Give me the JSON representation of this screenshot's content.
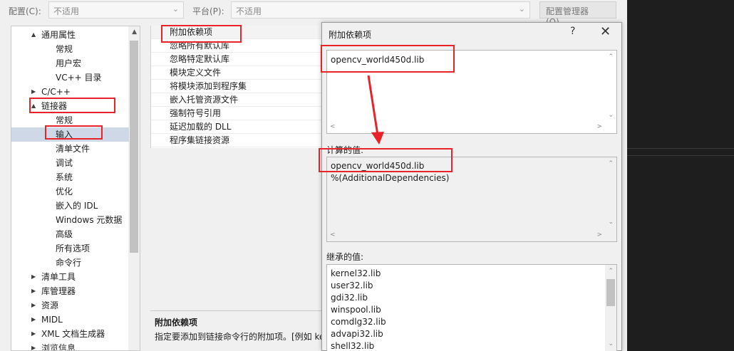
{
  "toolbar": {
    "config_label": "配置(C):",
    "config_value": "不适用",
    "platform_label": "平台(P):",
    "platform_value": "不适用",
    "config_manager_button": "配置管理器(O)..."
  },
  "tree": {
    "items": [
      {
        "label": "通用属性",
        "expander": "▲"
      },
      {
        "label": "常规"
      },
      {
        "label": "用户宏"
      },
      {
        "label": "VC++ 目录"
      },
      {
        "label": "C/C++",
        "expander": "▶"
      },
      {
        "label": "链接器",
        "expander": "▲"
      },
      {
        "label": "常规"
      },
      {
        "label": "输入"
      },
      {
        "label": "清单文件"
      },
      {
        "label": "调试"
      },
      {
        "label": "系统"
      },
      {
        "label": "优化"
      },
      {
        "label": "嵌入的 IDL"
      },
      {
        "label": "Windows 元数据"
      },
      {
        "label": "高级"
      },
      {
        "label": "所有选项"
      },
      {
        "label": "命令行"
      },
      {
        "label": "清单工具",
        "expander": "▶"
      },
      {
        "label": "库管理器",
        "expander": "▶"
      },
      {
        "label": "资源",
        "expander": "▶"
      },
      {
        "label": "MIDL",
        "expander": "▶"
      },
      {
        "label": "XML 文档生成器",
        "expander": "▶"
      },
      {
        "label": "浏览信息",
        "expander": "▶"
      }
    ]
  },
  "grid": {
    "rows": [
      "附加依赖项",
      "忽略所有默认库",
      "忽略特定默认库",
      "模块定义文件",
      "将模块添加到程序集",
      "嵌入托管资源文件",
      "强制符号引用",
      "延迟加载的 DLL",
      "程序集链接资源"
    ]
  },
  "description": {
    "title": "附加依赖项",
    "text": "指定要添加到链接命令行的附加项。[例如 ke"
  },
  "dialog": {
    "title": "附加依赖项",
    "help": "?",
    "close": "✕",
    "input_value": "opencv_world450d.lib",
    "computed_label": "计算的值:",
    "computed_values": [
      "opencv_world450d.lib",
      "%(AdditionalDependencies)"
    ],
    "inherited_label": "继承的值:",
    "inherited_values": [
      "kernel32.lib",
      "user32.lib",
      "gdi32.lib",
      "winspool.lib",
      "comdlg32.lib",
      "advapi32.lib",
      "shell32.lib"
    ]
  },
  "colors": {
    "annotation_red": "#e8232a",
    "selection": "#cfd8e6",
    "dark_panel": "#1e1e1e"
  }
}
